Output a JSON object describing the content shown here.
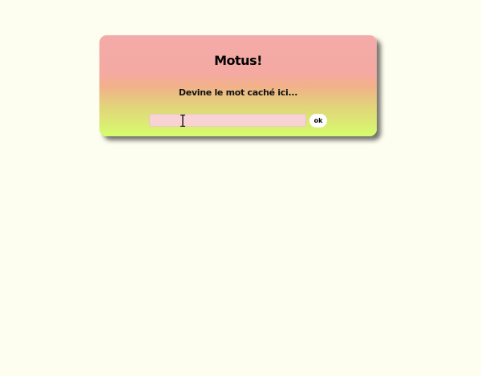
{
  "game": {
    "title": "Motus!",
    "subtitle": "Devine le mot caché ici...",
    "input_value": "",
    "input_placeholder": "",
    "ok_label": "ok"
  },
  "colors": {
    "page_background": "#fefef0",
    "card_gradient_top": "#f4aaa8",
    "card_gradient_mid": "#f2b08a",
    "card_gradient_bottom": "#d6fd6e",
    "input_background": "#f9d3d3",
    "button_background": "#ffffff"
  },
  "cursor": {
    "icon": "text-cursor-icon"
  }
}
